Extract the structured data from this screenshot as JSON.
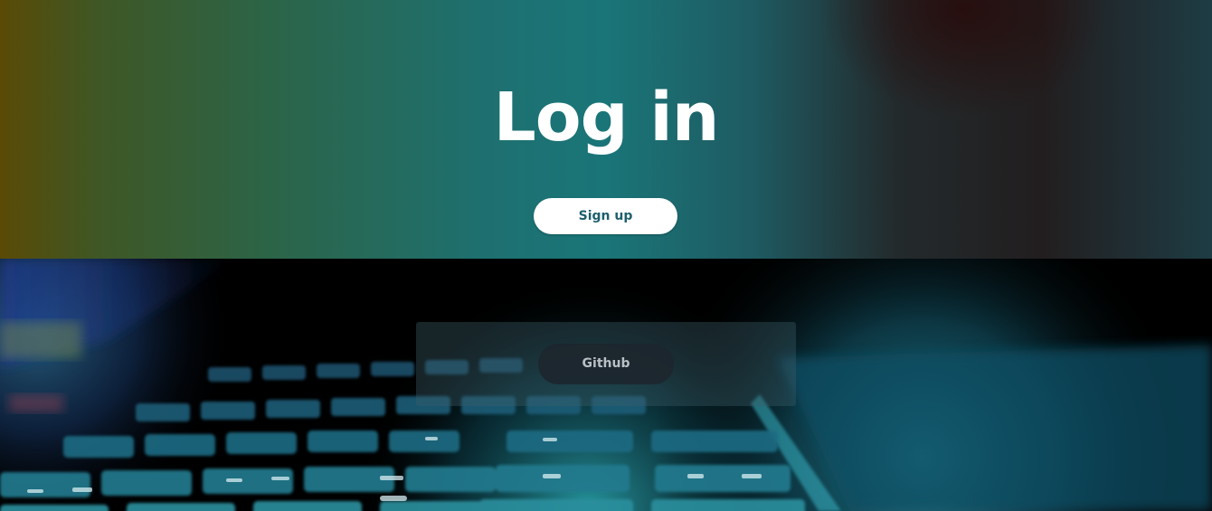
{
  "hero": {
    "title": "Log in",
    "signup_label": "Sign up"
  },
  "auth_panel": {
    "github_label": "Github"
  },
  "colors": {
    "title_text": "#ffffff",
    "signup_text": "#1c5f6c",
    "signup_bg": "#ffffff",
    "github_bg": "#1c262e",
    "github_text": "#b9c0c4"
  }
}
